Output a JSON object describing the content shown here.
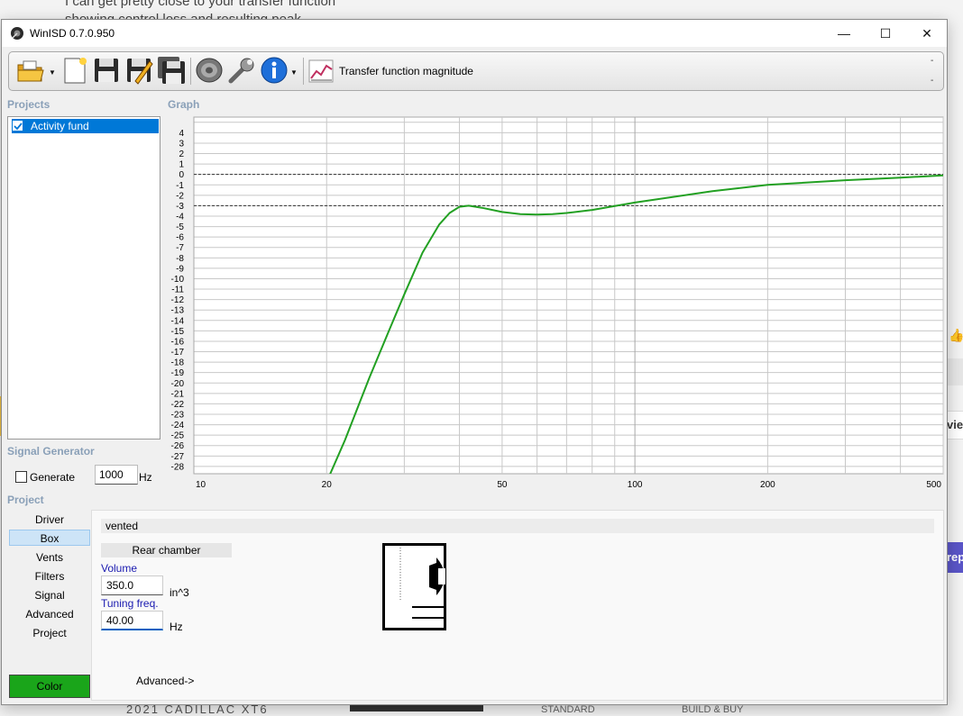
{
  "background": {
    "text_line1": "I can get pretty close to your transfer function",
    "text_line2": "showing control loss and resulting peak",
    "right_vie": "vie",
    "right_rep": "rep",
    "bottom_text": "2021 CADILLAC XT6",
    "bottom_standard": "STANDARD",
    "bottom_build": "BUILD & BUY"
  },
  "window": {
    "title": "WinISD 0.7.0.950",
    "minimize": "—",
    "maximize": "☐",
    "close": "✕"
  },
  "toolbar": {
    "graph_type_label": "Transfer function magnitude",
    "dash_top": "-",
    "dash_bottom": "-",
    "icons": [
      "open-folder-icon",
      "new-project-icon",
      "save-icon",
      "save-as-icon",
      "save-all-icon",
      "driver-icon",
      "tools-icon",
      "info-icon",
      "graph-type-icon"
    ]
  },
  "projects": {
    "label": "Projects",
    "items": [
      {
        "label": "Activity fund",
        "checked": true
      }
    ]
  },
  "graph": {
    "label": "Graph"
  },
  "chart_data": {
    "type": "line",
    "x_scale": "log",
    "xlim": [
      10,
      500
    ],
    "ylim": [
      -28,
      4
    ],
    "x_tick_labels": [
      "10",
      "20",
      "50",
      "100",
      "200",
      "500"
    ],
    "y_tick_labels": [
      "4",
      "3",
      "2",
      "1",
      "0",
      "-1",
      "-2",
      "-3",
      "-4",
      "-5",
      "-6",
      "-7",
      "-8",
      "-9",
      "-10",
      "-11",
      "-12",
      "-13",
      "-14",
      "-15",
      "-16",
      "-17",
      "-18",
      "-19",
      "-20",
      "-21",
      "-22",
      "-23",
      "-24",
      "-25",
      "-26",
      "-27",
      "-28"
    ],
    "grid": true,
    "reference_lines": [
      0,
      -3
    ],
    "series": [
      {
        "color": "#22a022",
        "x": [
          20,
          22,
          25,
          28,
          30,
          33,
          36,
          38,
          40,
          42,
          45,
          50,
          55,
          60,
          65,
          70,
          80,
          100,
          150,
          200,
          300,
          400,
          500
        ],
        "y": [
          -29.5,
          -25.5,
          -19.5,
          -14.5,
          -11.5,
          -7.5,
          -4.8,
          -3.7,
          -3.1,
          -3.0,
          -3.2,
          -3.6,
          -3.8,
          -3.85,
          -3.8,
          -3.7,
          -3.4,
          -2.7,
          -1.6,
          -1.0,
          -0.55,
          -0.3,
          -0.1
        ]
      }
    ]
  },
  "signal_generator": {
    "label": "Signal Generator",
    "generate_label": "Generate",
    "generate_checked": false,
    "frequency": "1000",
    "unit": "Hz"
  },
  "project_nav": {
    "label": "Project",
    "items": [
      "Driver",
      "Box",
      "Vents",
      "Filters",
      "Signal",
      "Advanced",
      "Project"
    ],
    "active": "Box",
    "color_button": "Color",
    "color_value": "#1aa51a"
  },
  "box": {
    "type": "vented",
    "rear_chamber": "Rear chamber",
    "volume_label": "Volume",
    "volume_value": "350.0",
    "volume_unit": "in^3",
    "tuning_label": "Tuning freq.",
    "tuning_value": "40.00",
    "tuning_unit": "Hz",
    "advanced_link": "Advanced->"
  }
}
